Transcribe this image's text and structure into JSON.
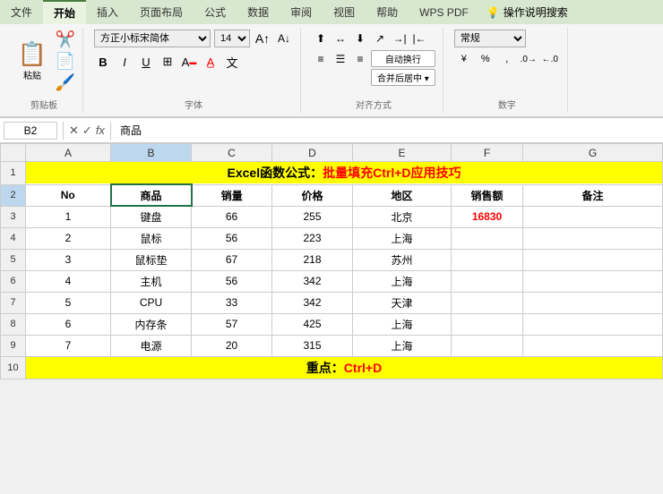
{
  "tabs": [
    "文件",
    "开始",
    "插入",
    "页面布局",
    "公式",
    "数据",
    "审阅",
    "视图",
    "帮助",
    "WPS PDF",
    "操作说明搜索"
  ],
  "activeTab": "开始",
  "clipboard": {
    "label": "剪贴板"
  },
  "font": {
    "label": "字体",
    "name": "方正小标宋简体",
    "size": "14",
    "boldLabel": "B",
    "italicLabel": "I",
    "underlineLabel": "U"
  },
  "alignment": {
    "label": "对齐方式",
    "wrapLabel": "自动换行",
    "mergeLabel": "合并后居中"
  },
  "number": {
    "label": "数字",
    "format": "常规",
    "percentSymbol": "%",
    "commaSymbol": ",",
    "increaseDecimal": ".00",
    "decreaseDecimal": ".0"
  },
  "formulaBar": {
    "cellRef": "B2",
    "content": "商品"
  },
  "columns": [
    "A",
    "B",
    "C",
    "D",
    "E",
    "F",
    "G"
  ],
  "rows": [
    {
      "num": "1",
      "cells": [
        {
          "colspan": 7,
          "text": "Excel函数公式：批量填充Ctrl+D应用技巧",
          "type": "title"
        }
      ]
    },
    {
      "num": "2",
      "cells": [
        {
          "text": "No",
          "type": "header"
        },
        {
          "text": "商品",
          "type": "header",
          "selected": true
        },
        {
          "text": "销量",
          "type": "header"
        },
        {
          "text": "价格",
          "type": "header"
        },
        {
          "text": "地区",
          "type": "header"
        },
        {
          "text": "销售额",
          "type": "header"
        },
        {
          "text": "备注",
          "type": "header"
        }
      ]
    },
    {
      "num": "3",
      "cells": [
        {
          "text": "1"
        },
        {
          "text": "键盘"
        },
        {
          "text": "66"
        },
        {
          "text": "255"
        },
        {
          "text": "北京"
        },
        {
          "text": "16830",
          "type": "red"
        },
        {
          "text": ""
        }
      ]
    },
    {
      "num": "4",
      "cells": [
        {
          "text": "2"
        },
        {
          "text": "鼠标"
        },
        {
          "text": "56"
        },
        {
          "text": "223"
        },
        {
          "text": "上海"
        },
        {
          "text": ""
        },
        {
          "text": ""
        }
      ]
    },
    {
      "num": "5",
      "cells": [
        {
          "text": "3"
        },
        {
          "text": "鼠标垫"
        },
        {
          "text": "67"
        },
        {
          "text": "218"
        },
        {
          "text": "苏州"
        },
        {
          "text": ""
        },
        {
          "text": ""
        }
      ]
    },
    {
      "num": "6",
      "cells": [
        {
          "text": "4"
        },
        {
          "text": "主机"
        },
        {
          "text": "56"
        },
        {
          "text": "342"
        },
        {
          "text": "上海"
        },
        {
          "text": ""
        },
        {
          "text": ""
        }
      ]
    },
    {
      "num": "7",
      "cells": [
        {
          "text": "5"
        },
        {
          "text": "CPU"
        },
        {
          "text": "33"
        },
        {
          "text": "342"
        },
        {
          "text": "天津"
        },
        {
          "text": ""
        },
        {
          "text": ""
        }
      ]
    },
    {
      "num": "8",
      "cells": [
        {
          "text": "6"
        },
        {
          "text": "内存条"
        },
        {
          "text": "57"
        },
        {
          "text": "425"
        },
        {
          "text": "上海"
        },
        {
          "text": ""
        },
        {
          "text": ""
        }
      ]
    },
    {
      "num": "9",
      "cells": [
        {
          "text": "7"
        },
        {
          "text": "电源"
        },
        {
          "text": "20"
        },
        {
          "text": "315"
        },
        {
          "text": "上海"
        },
        {
          "text": ""
        },
        {
          "text": ""
        }
      ]
    },
    {
      "num": "10",
      "cells": [
        {
          "colspan": 7,
          "text": "重点：Ctrl+D",
          "type": "bottom-note"
        }
      ]
    }
  ],
  "titleMain": "Excel函数公式：",
  "titleRed": "批量填充Ctrl+D应用技巧",
  "noteMain": "重点：",
  "noteRed": "Ctrl+D"
}
